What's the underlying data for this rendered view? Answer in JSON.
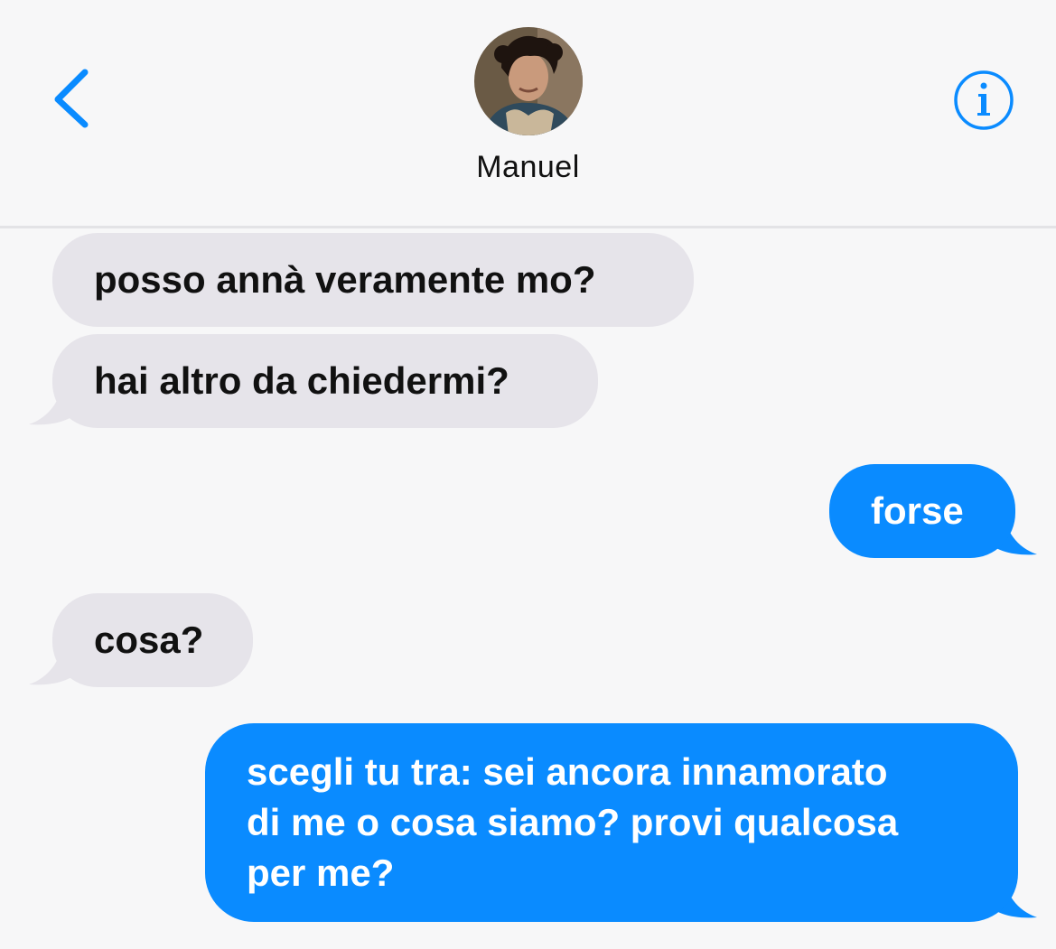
{
  "contact": {
    "name": "Manuel"
  },
  "messages": [
    {
      "direction": "incoming",
      "text": "posso annà veramente mo?"
    },
    {
      "direction": "incoming",
      "text": "hai altro da chiedermi?"
    },
    {
      "direction": "outgoing",
      "text": "forse"
    },
    {
      "direction": "incoming",
      "text": "cosa?"
    },
    {
      "direction": "outgoing",
      "lines": [
        "scegli tu tra: sei ancora innamorato",
        "di me o cosa siamo? provi qualcosa",
        "per me?"
      ]
    }
  ],
  "colors": {
    "accent": "#0a8bff",
    "incoming_bubble": "#e6e4ea",
    "background": "#f7f7f8"
  },
  "icons": {
    "back": "chevron-left-icon",
    "info": "info-icon"
  }
}
